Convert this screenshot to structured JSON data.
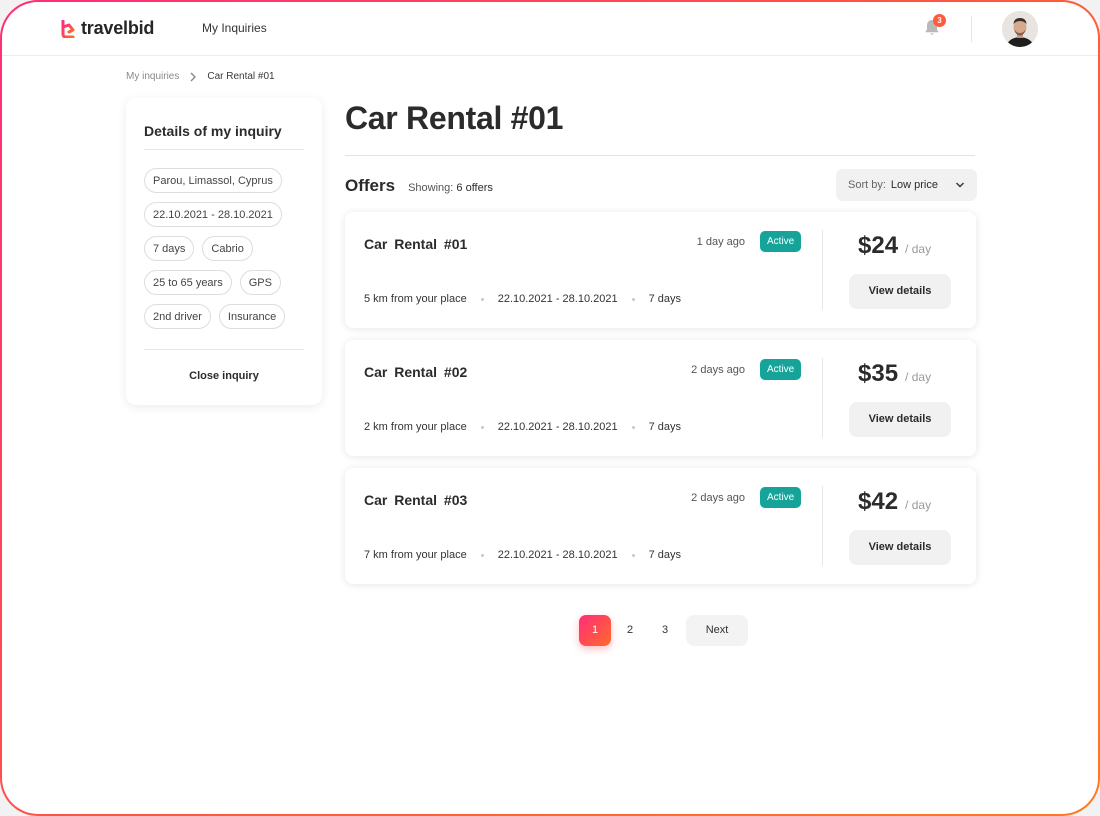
{
  "header": {
    "logo_text": "travelbid",
    "nav_link": "My Inquiries",
    "notification_count": "3",
    "brand_color": "#ff2d7a",
    "accent_color": "#ff6a2a"
  },
  "breadcrumb": {
    "items": [
      "My inquiries",
      "Car Rental #01"
    ]
  },
  "sidebar": {
    "title": "Details of my inquiry",
    "chips": [
      "Parou, Limassol, Cyprus",
      "22.10.2021 - 28.10.2021",
      "7 days",
      "Cabrio",
      "25 to 65 years",
      "GPS",
      "2nd driver",
      "Insurance"
    ],
    "close_label": "Close inquiry"
  },
  "main": {
    "title": "Car Rental #01",
    "offers_title": "Offers",
    "showing_label": "Showing:",
    "showing_value": "6 offers",
    "sort_label": "Sort by:",
    "sort_value": "Low price",
    "status_color": "#16a39a"
  },
  "offers": [
    {
      "name": "Car Rental  #01",
      "ago": "1 day ago",
      "status": "Active",
      "distance": "5 km from your place",
      "dates": "22.10.2021 - 28.10.2021",
      "duration": "7 days",
      "price": "$24",
      "unit": "/ day",
      "button": "View details"
    },
    {
      "name": "Car Rental  #02",
      "ago": "2 days ago",
      "status": "Active",
      "distance": "2 km from your place",
      "dates": "22.10.2021 - 28.10.2021",
      "duration": "7 days",
      "price": "$35",
      "unit": "/ day",
      "button": "View details"
    },
    {
      "name": "Car Rental  #03",
      "ago": "2 days ago",
      "status": "Active",
      "distance": "7 km from your place",
      "dates": "22.10.2021 - 28.10.2021",
      "duration": "7 days",
      "price": "$42",
      "unit": "/ day",
      "button": "View details"
    }
  ],
  "pagination": {
    "pages": [
      "1",
      "2",
      "3"
    ],
    "current": "1",
    "next_label": "Next"
  }
}
